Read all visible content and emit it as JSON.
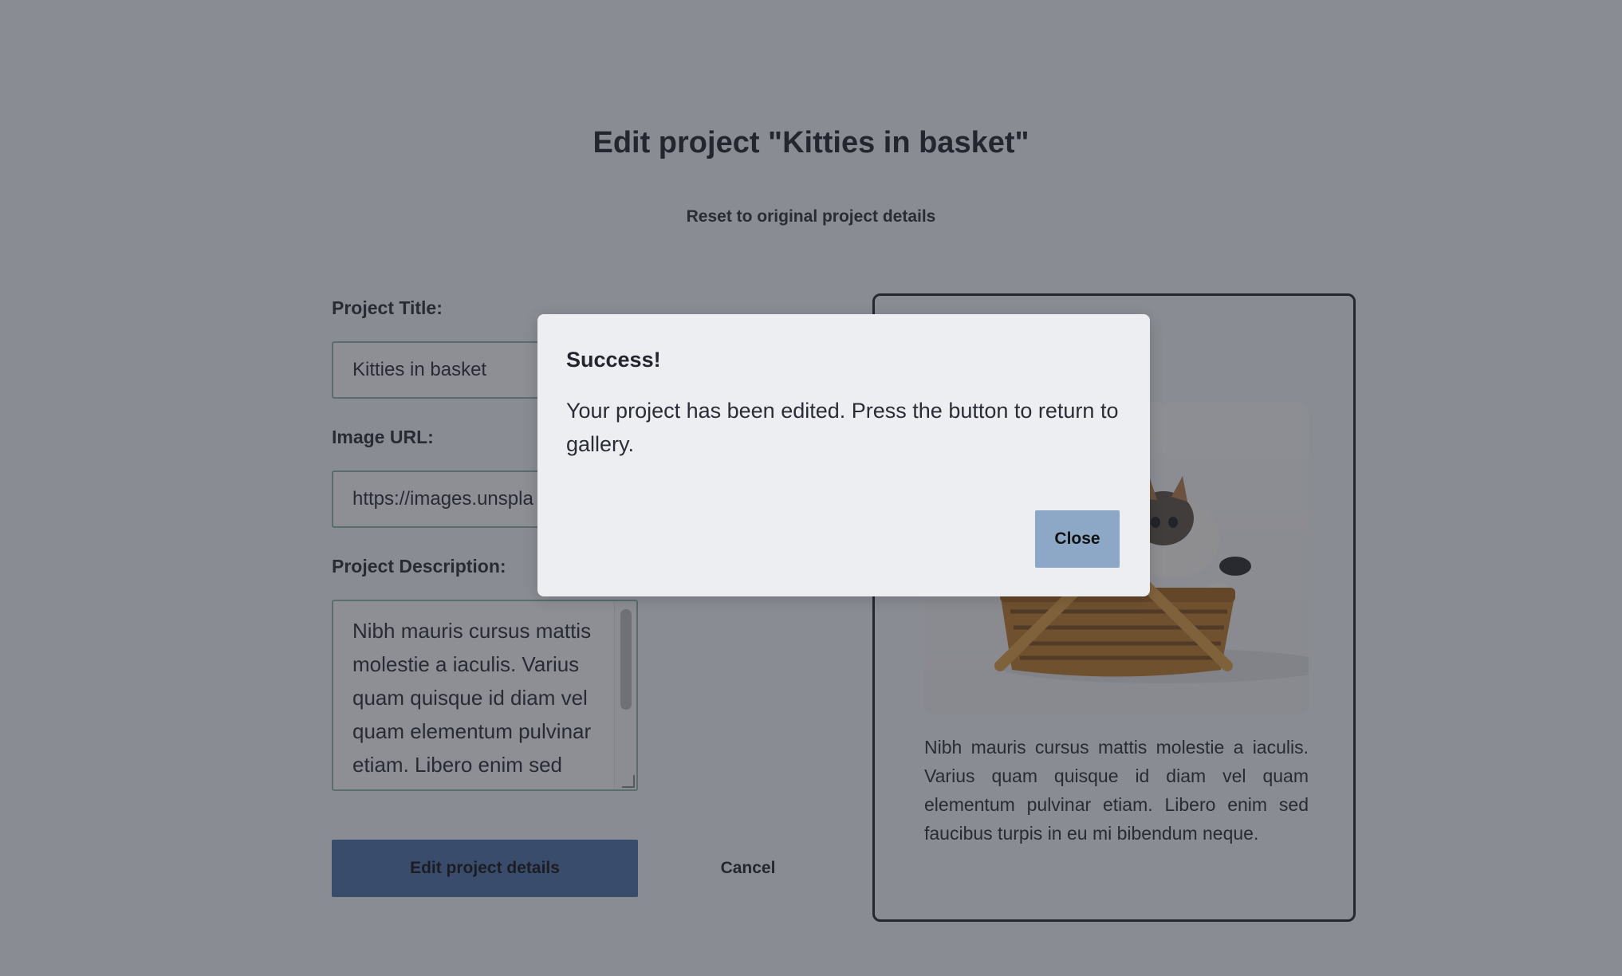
{
  "page": {
    "title": "Edit project \"Kitties in basket\"",
    "reset_link": "Reset to original project details"
  },
  "form": {
    "title_label": "Project Title:",
    "title_value": "Kitties in basket",
    "image_url_label": "Image URL:",
    "image_url_value": "https://images.unspla",
    "description_label": "Project Description:",
    "description_value": "Nibh mauris cursus mattis molestie a iaculis. Varius quam quisque id diam vel quam elementum pulvinar etiam. Libero enim sed faucibus turpis in eu mi bibendum neque.",
    "submit_label": "Edit project details",
    "cancel_label": "Cancel"
  },
  "preview": {
    "description": "Nibh mauris cursus mattis molestie a iaculis. Varius quam quisque id diam vel quam elementum pulvinar etiam. Libero enim sed faucibus turpis in eu mi bibendum neque."
  },
  "modal": {
    "title": "Success!",
    "body": "Your project has been edited. Press the button to return to gallery.",
    "close_label": "Close"
  },
  "colors": {
    "primary_button": "#4a6fa5",
    "close_button": "#8da7c7",
    "page_background": "#eceef2",
    "overlay": "rgba(39,42,52,0.5)"
  }
}
